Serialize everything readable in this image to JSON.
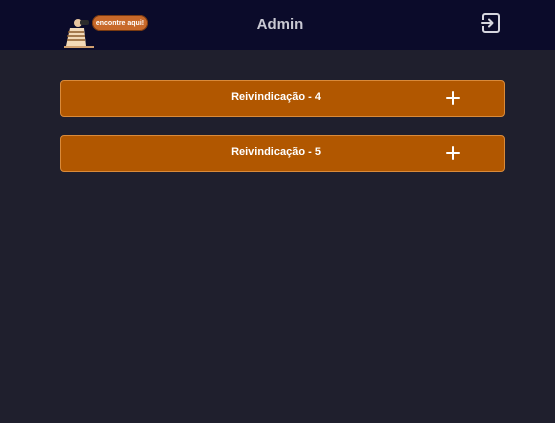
{
  "header": {
    "logo_text": "encontre aqui!",
    "title": "Admin",
    "logout_icon": "logout-icon"
  },
  "claims": [
    {
      "label": "Reivindicação - 4",
      "icon": "plus-icon"
    },
    {
      "label": "Reivindicação - 5",
      "icon": "plus-icon"
    }
  ],
  "colors": {
    "topbar_bg": "#0b0b2a",
    "page_bg": "#1f1f2d",
    "claim_bg": "#b15700",
    "claim_border": "#d98a3a",
    "title_text": "#c9c9d3"
  }
}
